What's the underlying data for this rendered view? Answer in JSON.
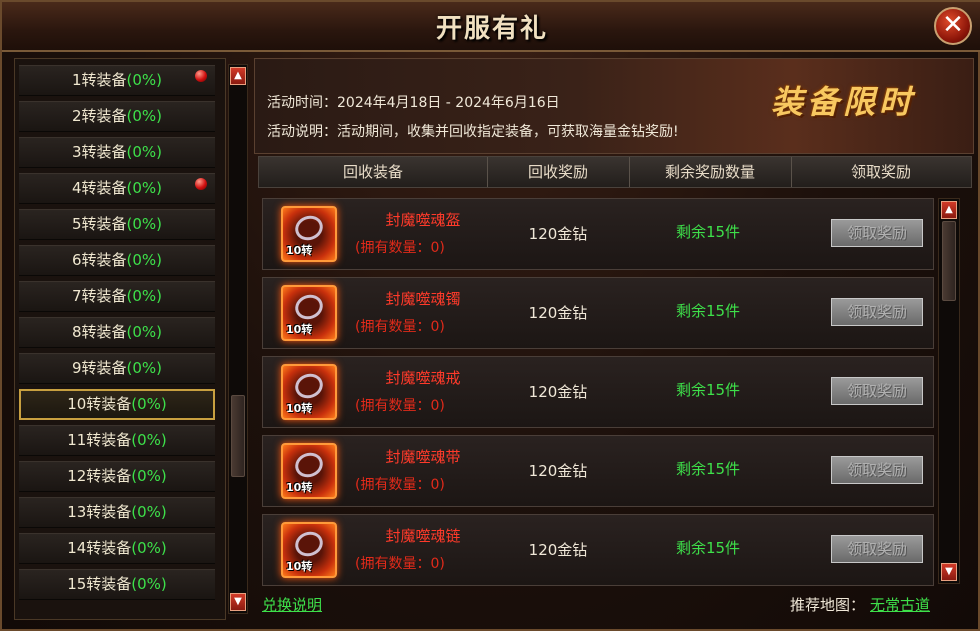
{
  "window": {
    "title": "开服有礼",
    "close_icon": "close-icon"
  },
  "sidebar": {
    "items": [
      {
        "label": "1转装备",
        "pct": "(0%)",
        "dot": true
      },
      {
        "label": "2转装备",
        "pct": "(0%)",
        "dot": false
      },
      {
        "label": "3转装备",
        "pct": "(0%)",
        "dot": false
      },
      {
        "label": "4转装备",
        "pct": "(0%)",
        "dot": true
      },
      {
        "label": "5转装备",
        "pct": "(0%)",
        "dot": false
      },
      {
        "label": "6转装备",
        "pct": "(0%)",
        "dot": false
      },
      {
        "label": "7转装备",
        "pct": "(0%)",
        "dot": false
      },
      {
        "label": "8转装备",
        "pct": "(0%)",
        "dot": false
      },
      {
        "label": "9转装备",
        "pct": "(0%)",
        "dot": false
      },
      {
        "label": "10转装备",
        "pct": "(0%)",
        "dot": false,
        "selected": true
      },
      {
        "label": "11转装备",
        "pct": "(0%)",
        "dot": false
      },
      {
        "label": "12转装备",
        "pct": "(0%)",
        "dot": false
      },
      {
        "label": "13转装备",
        "pct": "(0%)",
        "dot": false
      },
      {
        "label": "14转装备",
        "pct": "(0%)",
        "dot": false
      },
      {
        "label": "15转装备",
        "pct": "(0%)",
        "dot": false
      }
    ]
  },
  "banner": {
    "time": "活动时间：2024年4月18日 - 2024年6月16日",
    "desc": "活动说明：活动期间，收集并回收指定装备，可获取海量金钻奖励!",
    "headline": "装备限时"
  },
  "table": {
    "headers": [
      "回收装备",
      "回收奖励",
      "剩余奖励数量",
      "领取奖励"
    ],
    "rows": [
      {
        "name": "封魔噬魂盔",
        "owned": "(拥有数量：0)",
        "level": "10转",
        "reward": "120金钻",
        "remain": "剩余15件",
        "button": "领取奖励"
      },
      {
        "name": "封魔噬魂镯",
        "owned": "(拥有数量：0)",
        "level": "10转",
        "reward": "120金钻",
        "remain": "剩余15件",
        "button": "领取奖励"
      },
      {
        "name": "封魔噬魂戒",
        "owned": "(拥有数量：0)",
        "level": "10转",
        "reward": "120金钻",
        "remain": "剩余15件",
        "button": "领取奖励"
      },
      {
        "name": "封魔噬魂带",
        "owned": "(拥有数量：0)",
        "level": "10转",
        "reward": "120金钻",
        "remain": "剩余15件",
        "button": "领取奖励"
      },
      {
        "name": "封魔噬魂链",
        "owned": "(拥有数量：0)",
        "level": "10转",
        "reward": "120金钻",
        "remain": "剩余15件",
        "button": "领取奖励"
      }
    ]
  },
  "footer": {
    "exchange_link": "兑换说明",
    "map_label": "推荐地图：",
    "map_link": "无常古道"
  },
  "colors": {
    "accent_green": "#3ee04a",
    "item_red": "#ff3a2a",
    "headline_gold": "#f8c860"
  }
}
